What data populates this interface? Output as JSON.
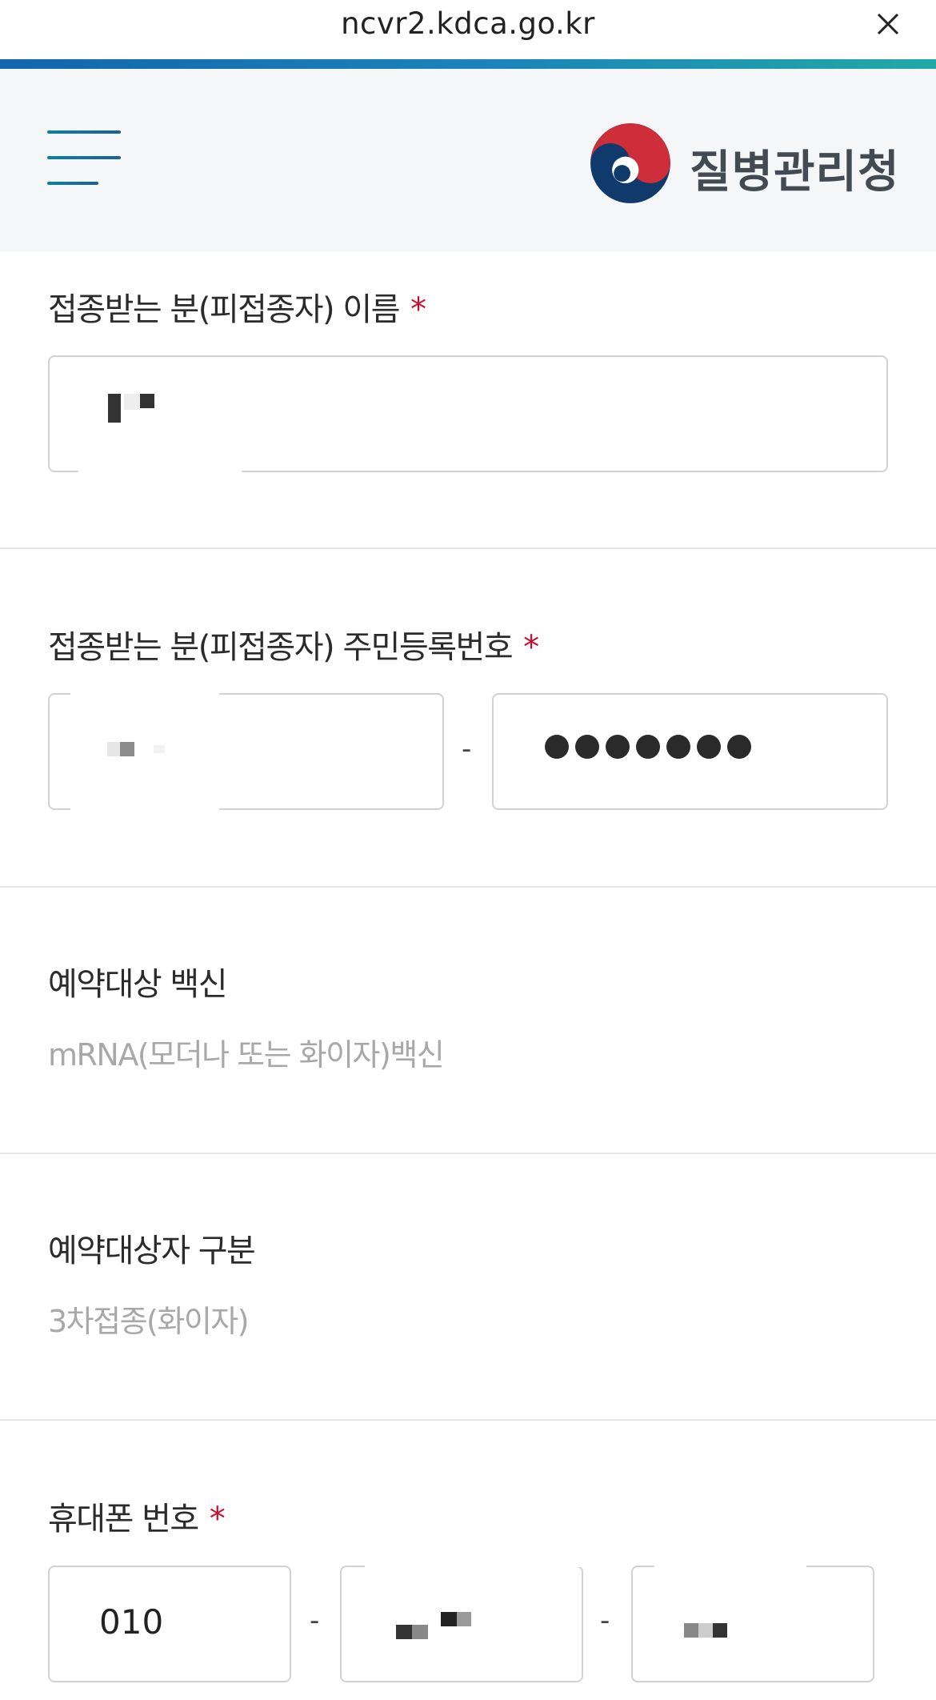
{
  "browser": {
    "url": "ncvr2.kdca.go.kr",
    "close_icon": "close-icon"
  },
  "header": {
    "menu_icon": "hamburger-menu-icon",
    "logo_text": "질병관리청",
    "colors": {
      "accent_blue": "#1265b0",
      "accent_teal": "#22a9a7",
      "logo_red": "#cd2e3a",
      "logo_navy": "#0f3a6b"
    }
  },
  "form": {
    "name": {
      "label": "접종받는 분(피접종자) 이름",
      "required_mark": "*"
    },
    "rrn": {
      "label": "접종받는 분(피접종자) 주민등록번호",
      "required_mark": "*",
      "separator": "-"
    },
    "vaccine": {
      "label": "예약대상 백신",
      "value": "mRNA(모더나 또는 화이자)백신"
    },
    "category": {
      "label": "예약대상자 구분",
      "value": "3차접종(화이자)"
    },
    "phone": {
      "label": "휴대폰 번호",
      "required_mark": "*",
      "prefix": "010",
      "separator1": "-",
      "separator2": "-"
    }
  }
}
